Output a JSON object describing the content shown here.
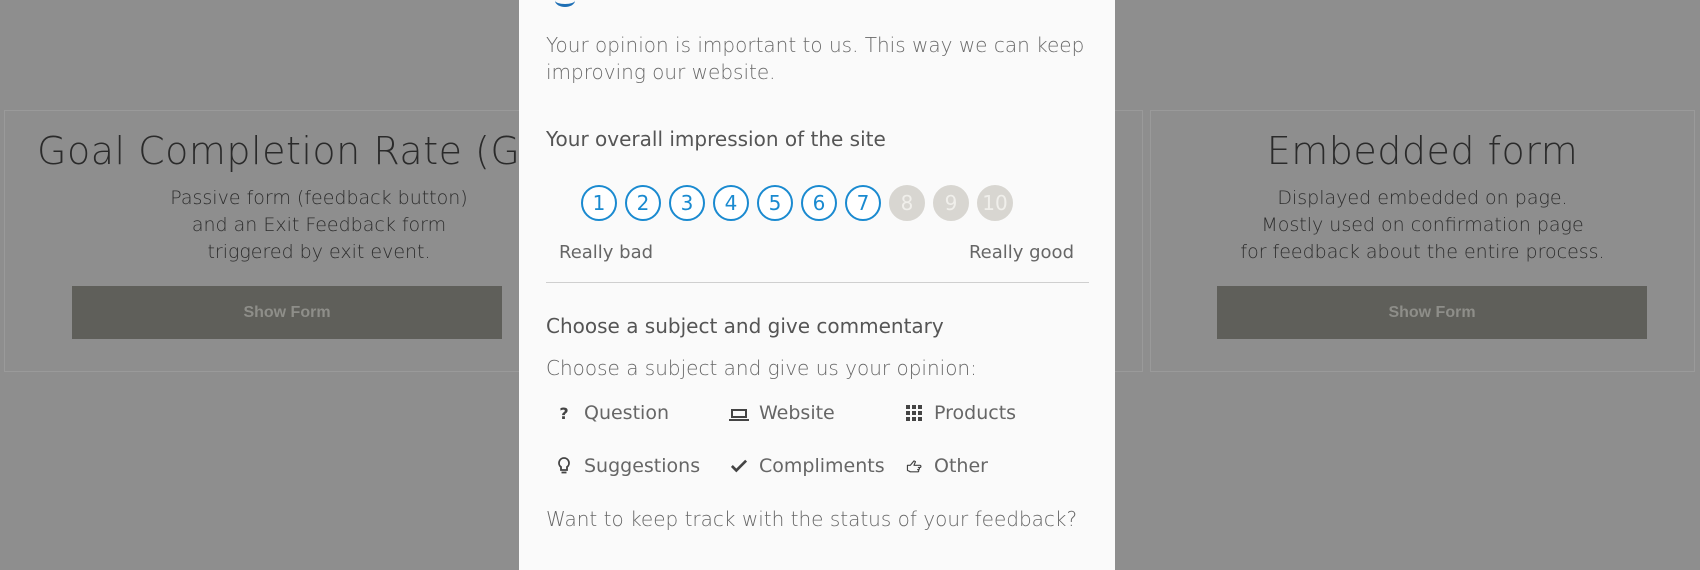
{
  "background_cards": {
    "left": {
      "title": "Goal Completion Rate (GCR)",
      "description": [
        "Passive form (feedback button)",
        "and an Exit Feedback form",
        "triggered by exit event."
      ],
      "button_label": "Show Form"
    },
    "right": {
      "title": "Embedded form",
      "description": [
        "Displayed embedded on page.",
        "Mostly used on confirmation page",
        "for feedback about the entire process."
      ],
      "button_label": "Show Form"
    }
  },
  "modal": {
    "intro": "Your opinion is important to us. This way we can keep improving our website.",
    "rating": {
      "title": "Your overall impression of the site",
      "options": [
        "1",
        "2",
        "3",
        "4",
        "5",
        "6",
        "7",
        "8",
        "9",
        "10"
      ],
      "selected": 7,
      "low_label": "Really bad",
      "high_label": "Really good",
      "active_color": "#1a8ad0",
      "inactive_color": "#d8d6d1"
    },
    "subject": {
      "title": "Choose a subject and give commentary",
      "prompt": "Choose a subject and give us your opinion:",
      "options": [
        {
          "label": "Question",
          "icon": "question-mark-icon"
        },
        {
          "label": "Website",
          "icon": "laptop-icon"
        },
        {
          "label": "Products",
          "icon": "grid-icon"
        },
        {
          "label": "Suggestions",
          "icon": "lightbulb-icon"
        },
        {
          "label": "Compliments",
          "icon": "checkmark-icon"
        },
        {
          "label": "Other",
          "icon": "pointing-hand-icon"
        }
      ]
    },
    "tracking_prompt": "Want to keep track with the status of your feedback?"
  }
}
